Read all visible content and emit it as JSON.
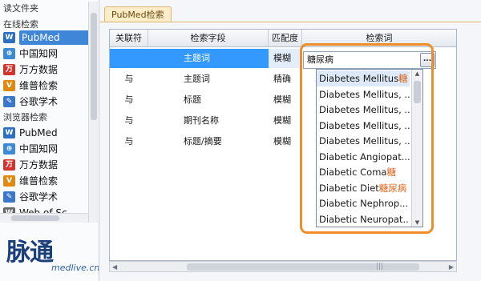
{
  "sidebar": {
    "partial_top_label": "读文件夹",
    "online_section": "在线检索",
    "online_items": [
      {
        "label": "PubMed",
        "icon": "pubmed-icon",
        "color": "#2e6fc2",
        "glyph": "W",
        "selected": true
      },
      {
        "label": "中国知网",
        "icon": "cnki-icon",
        "color": "#3c8ad6",
        "glyph": "⊕"
      },
      {
        "label": "万方数据",
        "icon": "wanfang-icon",
        "color": "#d0342c",
        "glyph": "万"
      },
      {
        "label": "维普检索",
        "icon": "vip-icon",
        "color": "#e08a14",
        "glyph": "V"
      },
      {
        "label": "谷歌学术",
        "icon": "google-scholar-icon",
        "color": "#3b78c9",
        "glyph": "✎"
      }
    ],
    "browser_section": "浏览器检索",
    "browser_items": [
      {
        "label": "PubMed",
        "icon": "pubmed-icon",
        "color": "#2e6fc2",
        "glyph": "W"
      },
      {
        "label": "中国知网",
        "icon": "cnki-icon",
        "color": "#3c8ad6",
        "glyph": "⊕"
      },
      {
        "label": "万方数据",
        "icon": "wanfang-icon",
        "color": "#d0342c",
        "glyph": "万"
      },
      {
        "label": "维普检索",
        "icon": "vip-icon",
        "color": "#e08a14",
        "glyph": "V"
      },
      {
        "label": "谷歌学术",
        "icon": "google-scholar-icon",
        "color": "#3b78c9",
        "glyph": "✎"
      },
      {
        "label": "Web of Sc",
        "icon": "web-of-science-icon",
        "color": "#666666",
        "glyph": "W"
      }
    ]
  },
  "logo": {
    "brand": "脉通",
    "sub": "medlive.cn"
  },
  "tab": {
    "label": "PubMed检索"
  },
  "grid": {
    "headers": [
      "关联符",
      "检索字段",
      "匹配度",
      "检索词"
    ],
    "rows": [
      {
        "op": "",
        "field": "主题词",
        "match": "模糊",
        "selected": true
      },
      {
        "op": "与",
        "field": "主题词",
        "match": "精确"
      },
      {
        "op": "与",
        "field": "标题",
        "match": "模糊"
      },
      {
        "op": "与",
        "field": "期刊名称",
        "match": "模糊"
      },
      {
        "op": "与",
        "field": "标题/摘要",
        "match": "模糊"
      }
    ]
  },
  "combo": {
    "value": "糖尿病",
    "button": "..."
  },
  "dropdown": {
    "items": [
      {
        "en": "Diabetes Mellitus",
        "cn": "糖"
      },
      {
        "en": "Diabetes Mellitus, ...",
        "cn": ""
      },
      {
        "en": "Diabetes Mellitus, ...",
        "cn": ""
      },
      {
        "en": "Diabetes Mellitus, ...",
        "cn": ""
      },
      {
        "en": "Diabetes Mellitus, ...",
        "cn": ""
      },
      {
        "en": "Diabetic Angiopat...",
        "cn": ""
      },
      {
        "en": "Diabetic Coma",
        "cn": "糖"
      },
      {
        "en": "Diabetic Diet",
        "cn": "糖尿病"
      },
      {
        "en": "Diabetic Nephrop...",
        "cn": ""
      },
      {
        "en": "Diabetic Neuropat...",
        "cn": ""
      }
    ]
  },
  "colors": {
    "accent_highlight": "#ee8d2a",
    "selection_blue": "#3399ff",
    "tab_bg": "#fdecc8"
  }
}
